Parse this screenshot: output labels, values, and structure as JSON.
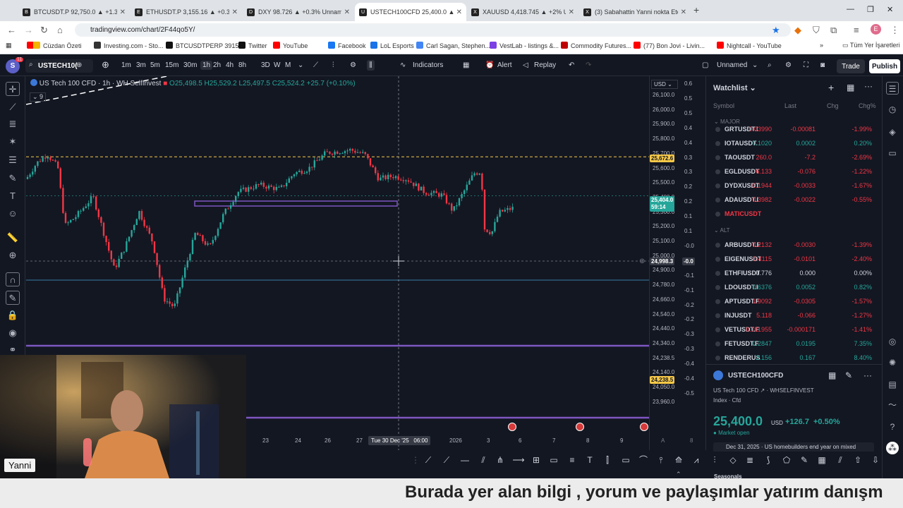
{
  "browser": {
    "tabs": [
      {
        "label": "BTCUSDT.P 92,750.0 ▲ +1.37%",
        "favicon": "B",
        "active": false
      },
      {
        "label": "ETHUSDT.P 3,155.16 ▲ +0.38%",
        "favicon": "E",
        "active": false
      },
      {
        "label": "DXY 98.726 ▲ +0.3% Unnamed",
        "favicon": "D",
        "active": false
      },
      {
        "label": "USTECH100CFD 25,400.0 ▲ +0.",
        "favicon": "U",
        "active": true
      },
      {
        "label": "XAUUSD 4,418.745 ▲ +2% Unn",
        "favicon": "X",
        "active": false
      },
      {
        "label": "(3) Sabahattin Yanni nokta Eteh",
        "favicon": "X",
        "active": false
      }
    ],
    "new_tab": "+",
    "url": "tradingview.com/chart/2F44qo5Y/",
    "profile_initial": "E",
    "bookmarks": [
      {
        "label": "",
        "color": "#ff0000"
      },
      {
        "label": "Cüzdan Özeti",
        "color": "#f4b400"
      },
      {
        "label": "Investing.com - Sto...",
        "color": "#333333"
      },
      {
        "label": "BTCUSDTPERP 3915...",
        "color": "#111111"
      },
      {
        "label": "Twitter",
        "color": "#111111"
      },
      {
        "label": "YouTube",
        "color": "#ff0000"
      },
      {
        "label": "Facebook",
        "color": "#1877f2"
      },
      {
        "label": "LoL Esports",
        "color": "#1a73e8"
      },
      {
        "label": "Carl Sagan, Stephen...",
        "color": "#4285f4"
      },
      {
        "label": "VestLab - listings &...",
        "color": "#7b3fe4"
      },
      {
        "label": "Commodity Futures...",
        "color": "#c00000"
      },
      {
        "label": "(77) Bon Jovi - Livin...",
        "color": "#ff0000"
      },
      {
        "label": "Nightcall - YouTube",
        "color": "#ff0000"
      }
    ],
    "all_bookmarks": "Tüm Yer İşaretleri"
  },
  "toolbar": {
    "symbol": "USTECH10(",
    "intervals": [
      "1m",
      "3m",
      "5m",
      "15m",
      "30m",
      "1h",
      "2h",
      "4h",
      "8h",
      "3D",
      "W",
      "M"
    ],
    "active_interval": "1h",
    "indicators": "Indicators",
    "alert": "Alert",
    "replay": "Replay",
    "layout_name": "Unnamed",
    "trade": "Trade",
    "publish": "Publish",
    "avatar": "S",
    "avatar_badge": "11"
  },
  "legend": {
    "title": "US Tech 100 CFD · 1h · WH SelfInvest",
    "ohlc": "O25,498.5 H25,529.2 L25,497.5 C25,524.2 +25.7 (+0.10%)",
    "indicator_count": "9"
  },
  "price_axis": {
    "currency": "USD",
    "ticks": [
      "26,100.0",
      "26,000.0",
      "25,900.0",
      "25,800.0",
      "25,700.0",
      "25,600.0",
      "25,500.0",
      "25,400.0",
      "25,300.0",
      "25,200.0",
      "25,100.0",
      "25,000.0",
      "24,900.0",
      "24,780.0",
      "24,660.0",
      "24,540.0",
      "24,440.0",
      "24,340.0",
      "24,238.5",
      "24,140.0",
      "24,050.0",
      "23,960.0"
    ],
    "indicator_ticks": [
      "0.6",
      "0.5",
      "0.5",
      "0.4",
      "0.4",
      "0.3",
      "0.3",
      "0.2",
      "0.2",
      "0.1",
      "0.1",
      "-0.0",
      "-0.0",
      "-0.1",
      "-0.1",
      "-0.2",
      "-0.2",
      "-0.3",
      "-0.3",
      "-0.4",
      "-0.4",
      "-0.5"
    ],
    "current_price": "25,404.0",
    "countdown": "59:14",
    "level_yellow": "25,672.6",
    "crosshair_price": "24,998.3",
    "crosshair_ind": "-0.0",
    "level_low": "24,238.5"
  },
  "time_axis": {
    "ticks": [
      "23",
      "24",
      "26",
      "27",
      "2026",
      "3",
      "6",
      "7",
      "8",
      "9"
    ],
    "crosshair_time": "Tue 30 Dec '25",
    "crosshair_hour": "06:00"
  },
  "watchlist": {
    "title": "Watchlist",
    "columns": [
      "Symbol",
      "Last",
      "Chg",
      "Chg%"
    ],
    "sections": {
      "major": "MAJOR",
      "alt": "ALT"
    },
    "major_rows": [
      {
        "symbol": "GRTUSDT.I",
        "last": "0.03990",
        "chg": "-0.00081",
        "pct": "-1.99%",
        "dir": "neg"
      },
      {
        "symbol": "IOTAUSDT.",
        "last": "0.1020",
        "chg": "0.0002",
        "pct": "0.20%",
        "dir": "pos"
      },
      {
        "symbol": "TAOUSDT",
        "last": "260.0",
        "chg": "-7.2",
        "pct": "-2.69%",
        "dir": "neg"
      },
      {
        "symbol": "EGLDUSDT",
        "last": "6.133",
        "chg": "-0.076",
        "pct": "-1.22%",
        "dir": "neg"
      },
      {
        "symbol": "DYDXUSDT",
        "last": "0.1944",
        "chg": "-0.0033",
        "pct": "-1.67%",
        "dir": "neg"
      },
      {
        "symbol": "ADAUSDT.I",
        "last": "0.3982",
        "chg": "-0.0022",
        "pct": "-0.55%",
        "dir": "neg"
      },
      {
        "symbol": "MATICUSDT",
        "last": "",
        "chg": "",
        "pct": "",
        "dir": "neu"
      }
    ],
    "alt_rows": [
      {
        "symbol": "ARBUSDT.F",
        "last": "0.2132",
        "chg": "-0.0030",
        "pct": "-1.39%",
        "dir": "neg"
      },
      {
        "symbol": "EIGENUSDT",
        "last": "0.4115",
        "chg": "-0.0101",
        "pct": "-2.40%",
        "dir": "neg"
      },
      {
        "symbol": "ETHFIUSDT",
        "last": "0.776",
        "chg": "0.000",
        "pct": "0.00%",
        "dir": "neu"
      },
      {
        "symbol": "LDOUSDT.I",
        "last": "0.6376",
        "chg": "0.0052",
        "pct": "0.82%",
        "dir": "pos"
      },
      {
        "symbol": "APTUSDT.F",
        "last": "1.9092",
        "chg": "-0.0305",
        "pct": "-1.57%",
        "dir": "neg"
      },
      {
        "symbol": "INJUSDT",
        "last": "5.118",
        "chg": "-0.066",
        "pct": "-1.27%",
        "dir": "neg"
      },
      {
        "symbol": "VETUSDT.F",
        "last": "0.011955",
        "chg": "-0.000171",
        "pct": "-1.41%",
        "dir": "neg"
      },
      {
        "symbol": "FETUSDT.F",
        "last": "0.2847",
        "chg": "0.0195",
        "pct": "7.35%",
        "dir": "pos"
      },
      {
        "symbol": "RENDERUS",
        "last": "2.156",
        "chg": "0.167",
        "pct": "8.40%",
        "dir": "pos"
      }
    ]
  },
  "detail": {
    "symbol": "USTECH100CFD",
    "name": "US Tech 100 CFD",
    "exchange": "WHSELFINVEST",
    "type": "Index · Cfd",
    "price": "25,400.0",
    "currency": "USD",
    "change": "+126.7",
    "change_pct": "+0.50%",
    "status": "Market open",
    "news": "Dec 31, 2025 · US homebuilders end year on mixed"
  },
  "bottom_panel": {
    "label": "Seasonals"
  },
  "webcam": {
    "name": "Yanni"
  },
  "subtitle": "Burada yer alan bilgi , yorum ve paylaşımlar yatırım danışm",
  "colors": {
    "up": "#26a69a",
    "down": "#f23645",
    "accent": "#2962ff",
    "level": "#7e57c2",
    "bg": "#131722"
  }
}
